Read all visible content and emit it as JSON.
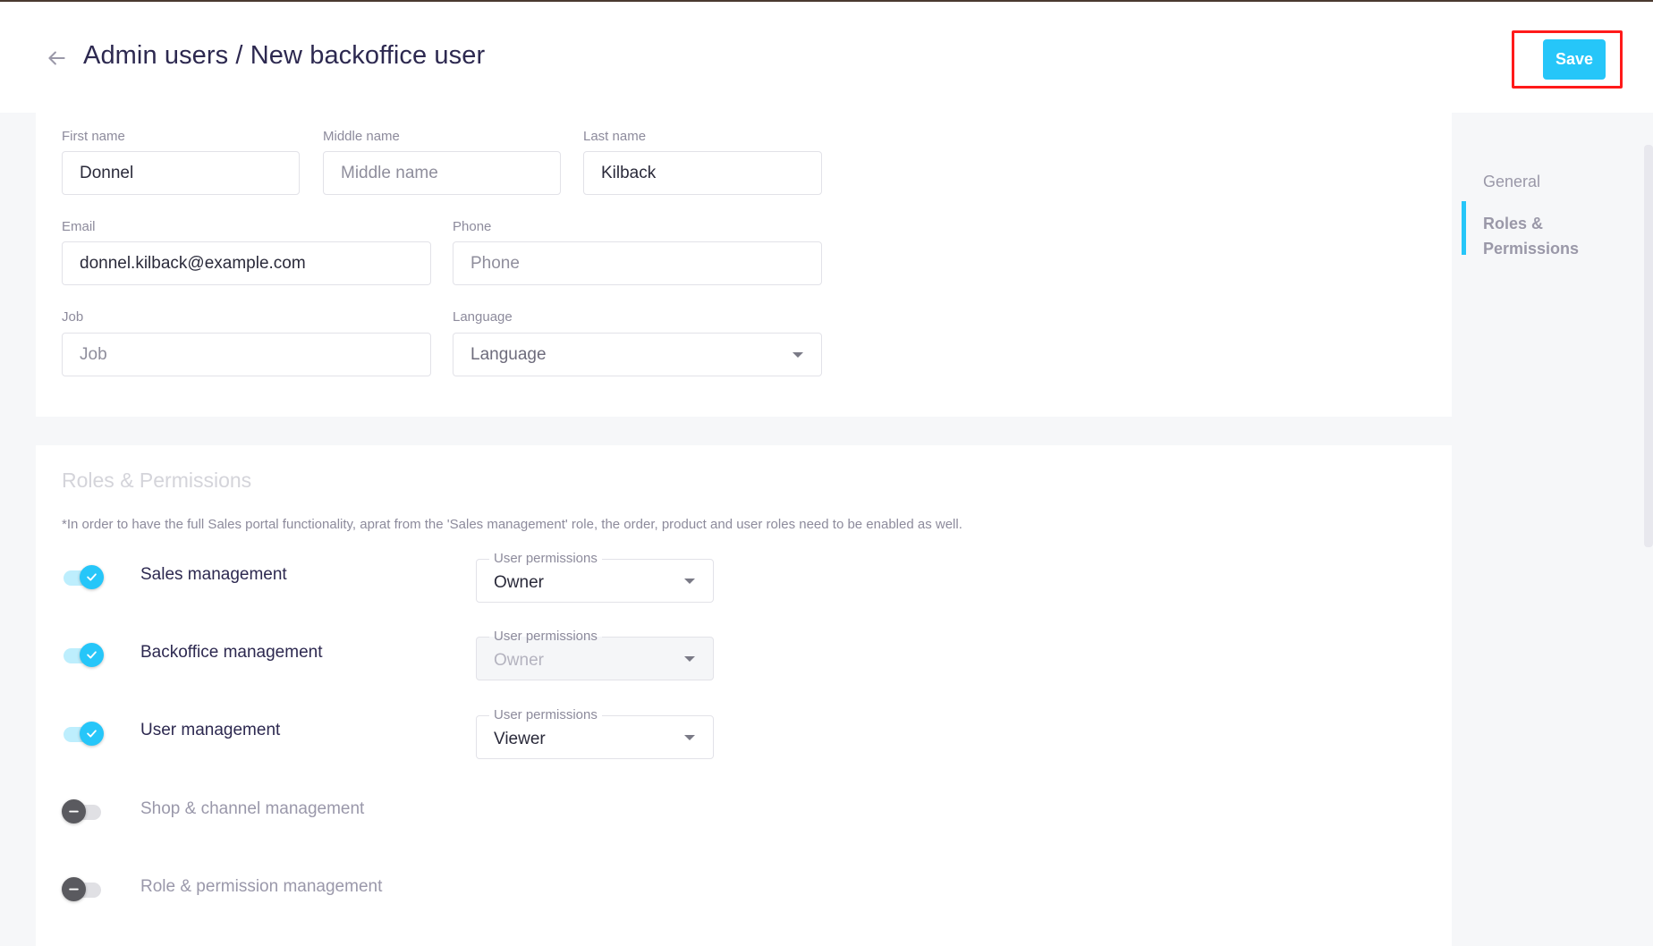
{
  "header": {
    "back_icon": "arrow-left-icon",
    "title": "Admin users / New backoffice user",
    "save_label": "Save",
    "highlight_color": "#ff1a1a",
    "accent_color": "#26c6f9"
  },
  "general": {
    "first_name": {
      "label": "First name",
      "value": "Donnel",
      "placeholder": "First name"
    },
    "middle_name": {
      "label": "Middle name",
      "value": "",
      "placeholder": "Middle name"
    },
    "last_name": {
      "label": "Last name",
      "value": "Kilback",
      "placeholder": "Last name"
    },
    "email": {
      "label": "Email",
      "value": "donnel.kilback@example.com",
      "placeholder": "Email"
    },
    "phone": {
      "label": "Phone",
      "value": "",
      "placeholder": "Phone"
    },
    "job": {
      "label": "Job",
      "value": "",
      "placeholder": "Job"
    },
    "language": {
      "label": "Language",
      "value": "Language",
      "icon": "caret-down-icon"
    }
  },
  "roles": {
    "title": "Roles & Permissions",
    "note": "*In order to have the full Sales portal functionality, aprat from the 'Sales management' role, the order, product and user roles need to be enabled as well.",
    "items": [
      {
        "label": "Sales management",
        "enabled": true,
        "permission_label": "User permissions",
        "permission_value": "Owner",
        "permission_disabled": false
      },
      {
        "label": "Backoffice management",
        "enabled": true,
        "permission_label": "User permissions",
        "permission_value": "Owner",
        "permission_disabled": true
      },
      {
        "label": "User management",
        "enabled": true,
        "permission_label": "User permissions",
        "permission_value": "Viewer",
        "permission_disabled": false
      },
      {
        "label": "Shop & channel management",
        "enabled": false
      },
      {
        "label": "Role & permission management",
        "enabled": false
      }
    ]
  },
  "side_nav": {
    "items": [
      {
        "label": "General",
        "active": false
      },
      {
        "label": "Roles & Permissions",
        "active": true
      }
    ]
  }
}
